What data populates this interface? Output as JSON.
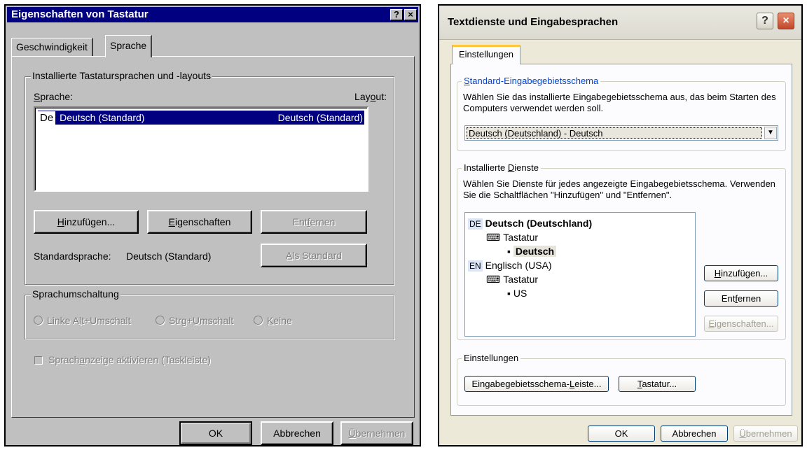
{
  "left_dialog": {
    "title": "Eigenschaften von Tastatur",
    "title_buttons": {
      "help": "?",
      "close": "×"
    },
    "tabs": [
      {
        "label": "Geschwindigkeit"
      },
      {
        "label": "Sprache"
      }
    ],
    "installed_group": {
      "label": "Installierte Tastatursprachen und -layouts",
      "col_language": "Sprache:",
      "col_layout": "Layout:",
      "rows": [
        {
          "icon_text": "De",
          "language": "Deutsch (Standard)",
          "layout": "Deutsch (Standard)"
        }
      ],
      "buttons": {
        "add": "Hinzufügen...",
        "properties": "Eigenschaften",
        "remove": "Entfernen",
        "set_default": "Als Standard"
      },
      "default_language_label": "Standardsprache:",
      "default_language_value": "Deutsch (Standard)"
    },
    "switch_group": {
      "label": "Sprachumschaltung",
      "options": [
        "Linke Alt+Umschalt",
        "Strg+Umschalt",
        "Keine"
      ]
    },
    "checkbox_label": "Sprachanzeige aktivieren (Taskleiste)",
    "footer": {
      "ok": "OK",
      "cancel": "Abbrechen",
      "apply": "Übernehmen"
    }
  },
  "right_dialog": {
    "title": "Textdienste und Eingabesprachen",
    "title_buttons": {
      "help": "?",
      "close": "×"
    },
    "tab": "Einstellungen",
    "default_group": {
      "label": "Standard-Eingabegebietsschema",
      "description": "Wählen Sie das installierte Eingabegebietsschema aus, das beim Starten des Computers verwendet werden soll.",
      "selected": "Deutsch (Deutschland) - Deutsch"
    },
    "services_group": {
      "label": "Installierte Dienste",
      "description": "Wählen Sie Dienste für jedes angezeigte Eingabegebietsschema. Verwenden Sie die Schaltflächen \"Hinzufügen\" und \"Entfernen\".",
      "tree": [
        {
          "badge": "DE",
          "label": "Deutsch (Deutschland)",
          "children_label": "Tastatur",
          "layout": "Deutsch"
        },
        {
          "badge": "EN",
          "label": "Englisch (USA)",
          "children_label": "Tastatur",
          "layout": "US"
        }
      ],
      "buttons": {
        "add": "Hinzufügen...",
        "remove": "Entfernen",
        "properties": "Eigenschaften..."
      }
    },
    "settings_group": {
      "label": "Einstellungen",
      "buttons": {
        "language_bar": "Eingabegebietsschema-Leiste...",
        "keyboard": "Tastatur..."
      }
    },
    "footer": {
      "ok": "OK",
      "cancel": "Abbrechen",
      "apply": "Übernehmen"
    }
  }
}
